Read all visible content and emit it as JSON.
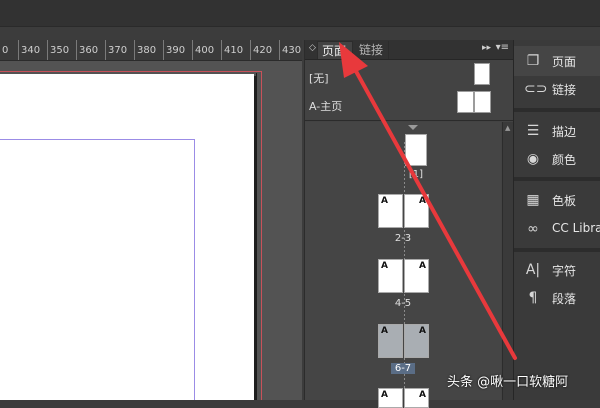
{
  "ruler": {
    "labels": [
      "0",
      "340",
      "350",
      "360",
      "370",
      "380",
      "390",
      "400",
      "410",
      "420",
      "430"
    ]
  },
  "panel": {
    "tabs": {
      "active": "页面",
      "inactive": "链接"
    },
    "masters": {
      "none": "[无]",
      "a_master": "A-主页"
    },
    "pages": [
      {
        "label": "1",
        "prefix": ""
      },
      {
        "label": "2-3",
        "left": "A",
        "right": "A"
      },
      {
        "label": "4-5",
        "left": "A",
        "right": "A"
      },
      {
        "label": "6-7",
        "left": "A",
        "right": "A",
        "selected": true
      },
      {
        "left": "A",
        "right": "A"
      }
    ],
    "page1_label": "[1]"
  },
  "dock": {
    "items": [
      {
        "label": "页面",
        "icon": "pages-icon"
      },
      {
        "label": "链接",
        "icon": "links-icon"
      },
      {
        "label": "描边",
        "icon": "stroke-icon"
      },
      {
        "label": "颜色",
        "icon": "color-palette-icon"
      },
      {
        "label": "色板",
        "icon": "swatches-icon"
      },
      {
        "label": "CC Libra",
        "icon": "cc-libraries-icon"
      },
      {
        "label": "字符",
        "icon": "character-icon"
      },
      {
        "label": "段落",
        "icon": "paragraph-icon"
      }
    ]
  },
  "watermark": "头条 @啾一口软糖阿",
  "colors": {
    "arrow": "#e8393c",
    "selected_page": "#a9aeb3",
    "selected_label": "#5a6d86"
  }
}
